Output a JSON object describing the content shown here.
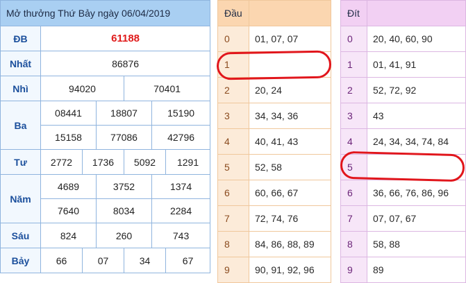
{
  "results": {
    "title": "Mở thưởng Thứ Bảy ngày 06/04/2019",
    "db": {
      "label": "ĐB",
      "value": "61188"
    },
    "nhat": {
      "label": "Nhất",
      "value": "86876"
    },
    "nhi": {
      "label": "Nhì",
      "values": [
        "94020",
        "70401"
      ]
    },
    "ba": {
      "label": "Ba",
      "row1": [
        "08441",
        "18807",
        "15190"
      ],
      "row2": [
        "15158",
        "77086",
        "42796"
      ]
    },
    "tu": {
      "label": "Tư",
      "values": [
        "2772",
        "1736",
        "5092",
        "1291"
      ]
    },
    "nam": {
      "label": "Năm",
      "row1": [
        "4689",
        "3752",
        "1374"
      ],
      "row2": [
        "7640",
        "8034",
        "2284"
      ]
    },
    "sau": {
      "label": "Sáu",
      "values": [
        "824",
        "260",
        "743"
      ]
    },
    "bay": {
      "label": "Bảy",
      "values": [
        "66",
        "07",
        "34",
        "67"
      ]
    }
  },
  "dau": {
    "header": "Đầu",
    "rows": [
      {
        "key": "0",
        "value": "01, 07, 07"
      },
      {
        "key": "1",
        "value": ""
      },
      {
        "key": "2",
        "value": "20, 24"
      },
      {
        "key": "3",
        "value": "34, 34, 36"
      },
      {
        "key": "4",
        "value": "40, 41, 43"
      },
      {
        "key": "5",
        "value": "52, 58"
      },
      {
        "key": "6",
        "value": "60, 66, 67"
      },
      {
        "key": "7",
        "value": "72, 74, 76"
      },
      {
        "key": "8",
        "value": "84, 86, 88, 89"
      },
      {
        "key": "9",
        "value": "90, 91, 92, 96"
      }
    ]
  },
  "dit": {
    "header": "Đít",
    "rows": [
      {
        "key": "0",
        "value": "20, 40, 60, 90"
      },
      {
        "key": "1",
        "value": "01, 41, 91"
      },
      {
        "key": "2",
        "value": "52, 72, 92"
      },
      {
        "key": "3",
        "value": "43"
      },
      {
        "key": "4",
        "value": "24, 34, 34, 74, 84"
      },
      {
        "key": "5",
        "value": ""
      },
      {
        "key": "6",
        "value": "36, 66, 76, 86, 96"
      },
      {
        "key": "7",
        "value": "07, 07, 67"
      },
      {
        "key": "8",
        "value": "58, 88"
      },
      {
        "key": "9",
        "value": "89"
      }
    ]
  },
  "colors": {
    "special_prize": "#e01b1b",
    "highlight": "#e1161c",
    "results_header": "#a9cff2",
    "dau_header": "#fbd6b0",
    "dit_header": "#f2d0f3"
  }
}
